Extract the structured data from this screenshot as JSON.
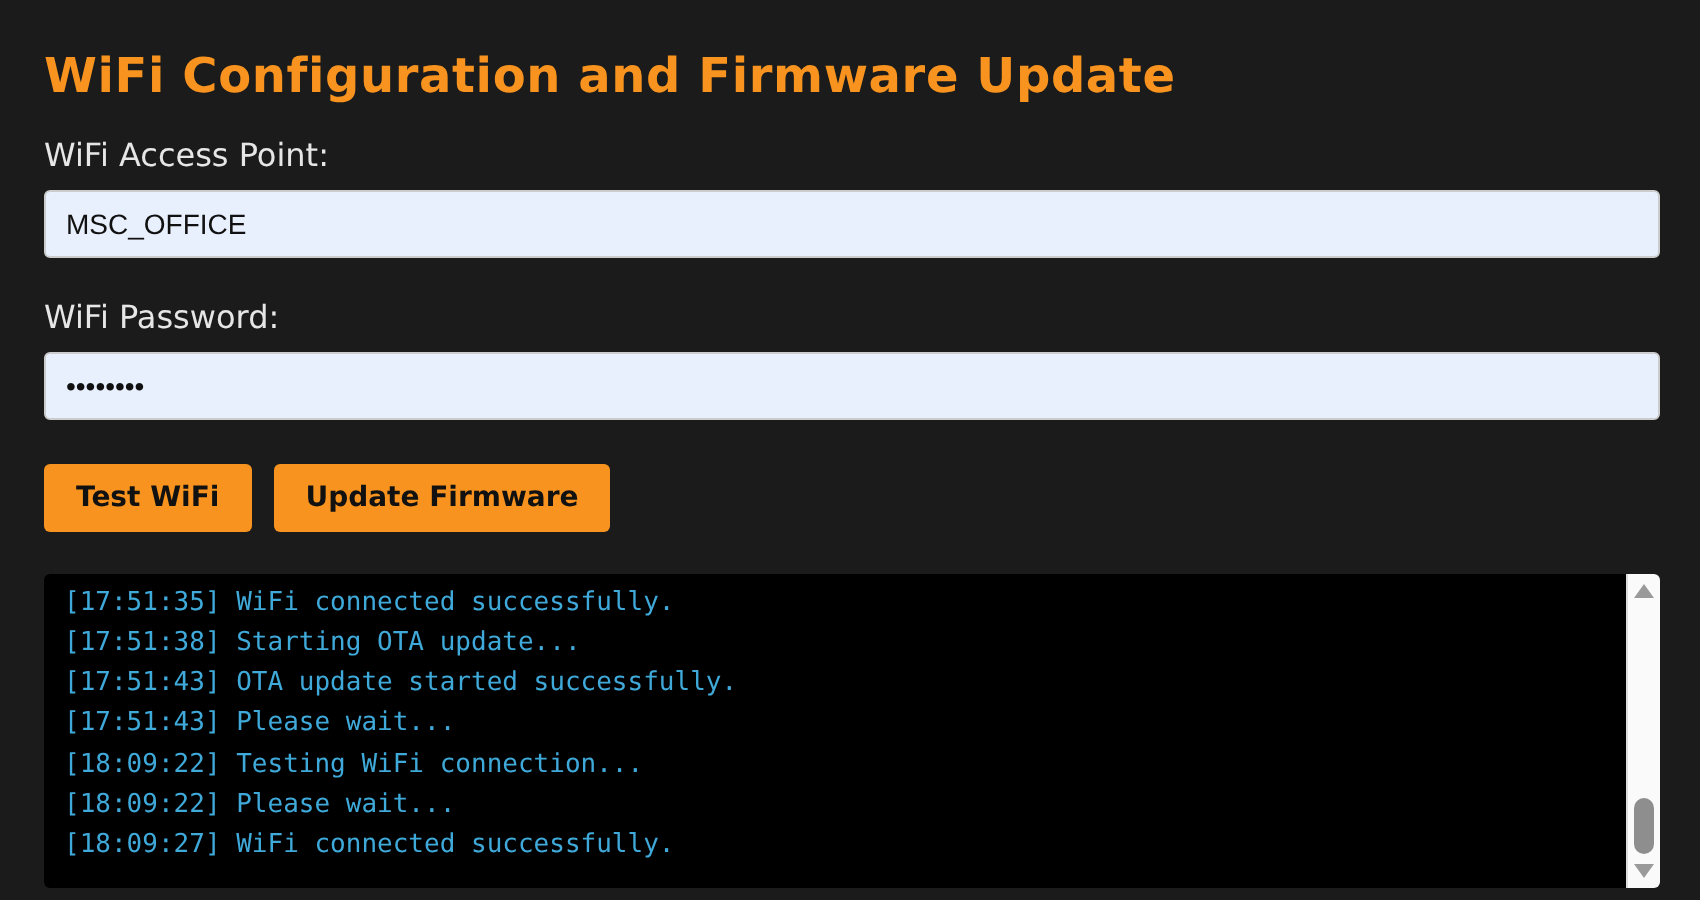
{
  "title": "WiFi Configuration and Firmware Update",
  "fields": [
    {
      "label": "WiFi Access Point:",
      "value": "MSC_OFFICE"
    },
    {
      "label": "WiFi Password:",
      "value": "••••••••"
    }
  ],
  "buttons": [
    "Test WiFi",
    "Update Firmware"
  ],
  "log": [
    "[17:51:35] WiFi connected successfully.",
    "[17:51:38] Starting OTA update...",
    "[17:51:43] OTA update started successfully.",
    "[17:51:43] Please wait...",
    "[18:09:22] Testing WiFi connection...",
    "[18:09:22] Please wait...",
    "[18:09:27] WiFi connected successfully."
  ]
}
